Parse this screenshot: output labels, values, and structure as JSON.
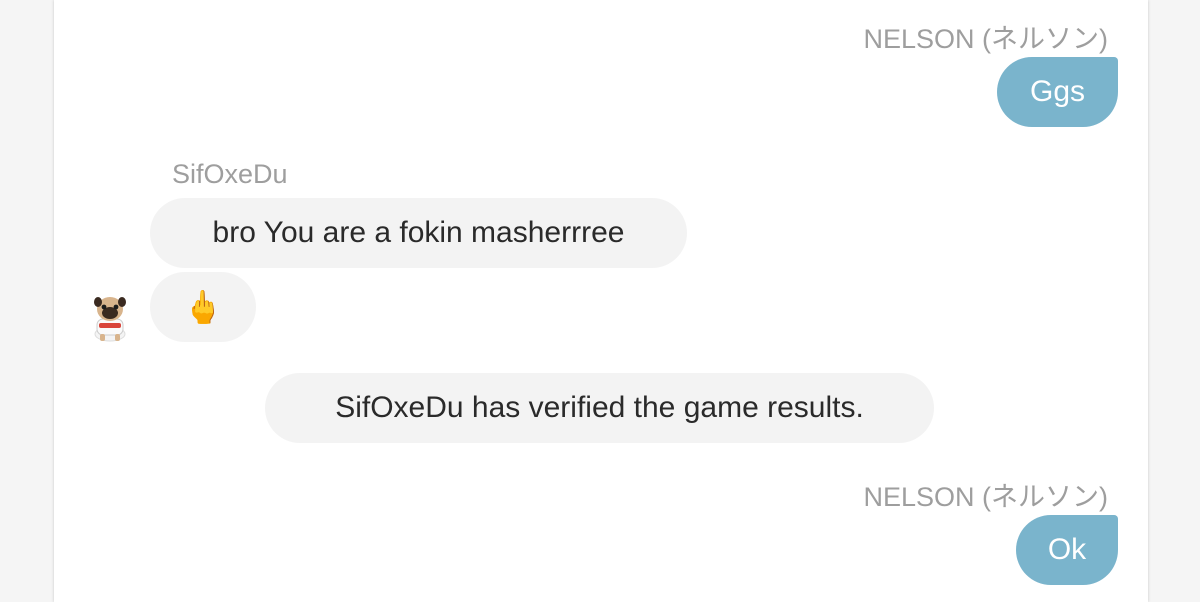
{
  "messages": [
    {
      "sender": "NELSON (ネルソン)",
      "text": "Ggs",
      "direction": "outgoing"
    },
    {
      "sender": "SifOxeDu",
      "text": "bro You are a fokin masherrree",
      "direction": "incoming"
    },
    {
      "sender": "SifOxeDu",
      "text": "🖕",
      "direction": "incoming"
    },
    {
      "system": "SifOxeDu has verified the game results."
    },
    {
      "sender": "NELSON (ネルソン)",
      "text": "Ok",
      "direction": "outgoing"
    }
  ],
  "avatar_icon": "pug-avatar-icon",
  "colors": {
    "outgoing_bubble": "#7ab4cc",
    "incoming_bubble": "#f3f3f3",
    "sender_name": "#9e9e9e",
    "page_background": "#f5f5f5"
  }
}
